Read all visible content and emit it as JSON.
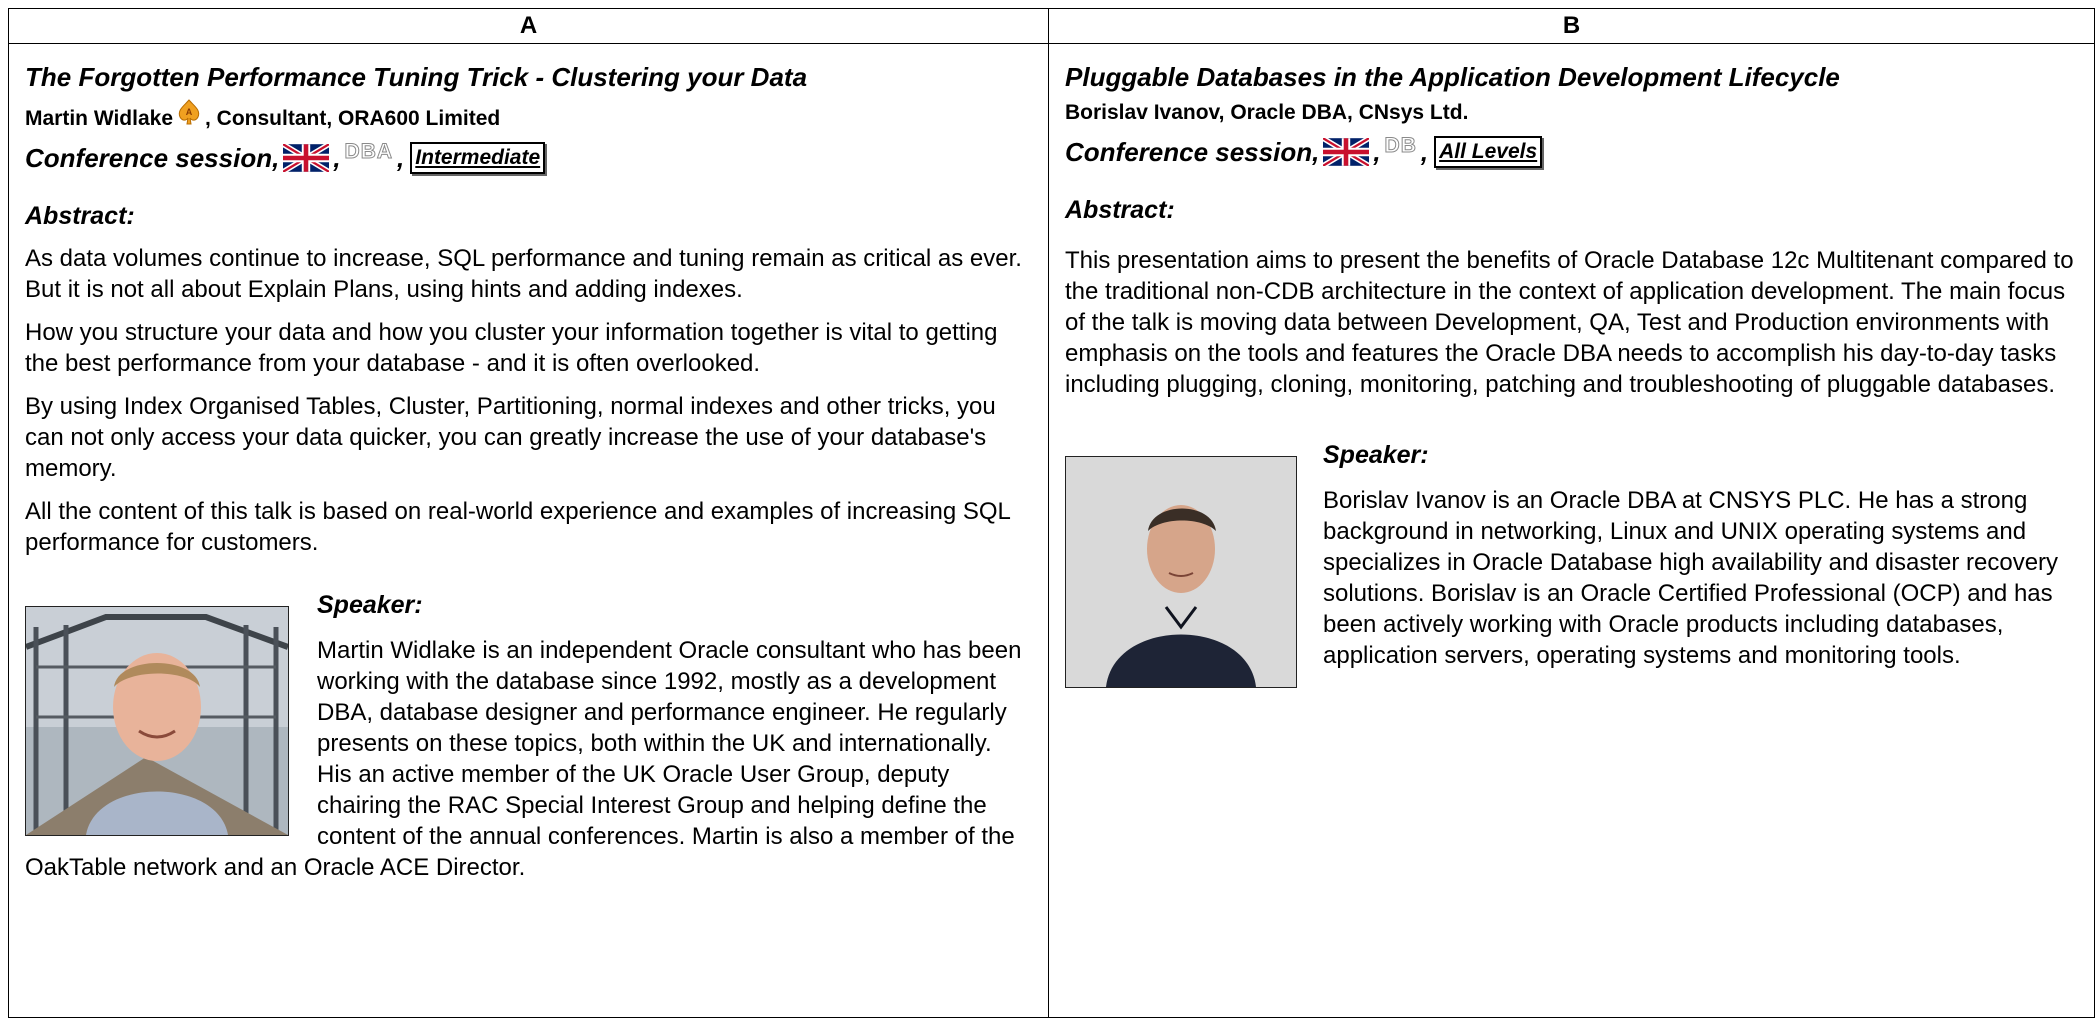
{
  "columns": [
    "A",
    "B"
  ],
  "col_a": {
    "title": "The Forgotten Performance Tuning Trick - Clustering your Data",
    "speaker_line": "Martin Widlake",
    "speaker_line_rest": ", Consultant, ORA600 Limited",
    "session_prefix": "Conference session,",
    "sep1": ",",
    "track_icon_text": "DBA",
    "sep2": ",",
    "level": "Intermediate",
    "abstract_heading": "Abstract:",
    "abstract_paragraphs": [
      "As data volumes continue to increase, SQL performance and tuning remain as critical as ever. But it is not all about Explain Plans, using hints and adding indexes.",
      "How you structure your data and how you cluster your information together is vital to getting the best performance from your database - and it is often overlooked.",
      "By using Index Organised Tables, Cluster, Partitioning, normal indexes and other tricks, you can not only access your data quicker, you can greatly increase the use of your database's memory.",
      "All the content of this talk is based on real-world experience and examples of increasing SQL performance for customers."
    ],
    "speaker_heading": "Speaker:",
    "bio": "Martin Widlake is an independent Oracle consultant who has been working with the database since 1992, mostly as a development DBA, database designer and performance engineer. He regularly presents on these topics, both within the UK and internationally. His an active member of the UK Oracle User Group, deputy chairing the RAC Special Interest Group and helping define the content of the annual conferences. Martin is also a member of the OakTable network and an Oracle ACE Director."
  },
  "col_b": {
    "title": "Pluggable Databases in the Application Development Lifecycle",
    "speaker_line": "Borislav Ivanov, Oracle DBA, CNsys Ltd.",
    "session_prefix": "Conference session,",
    "sep1": ",",
    "track_icon_text": "DB",
    "sep2": ",",
    "level": "All Levels",
    "abstract_heading": "Abstract:",
    "abstract_paragraphs": [
      "This presentation aims to present the benefits of Oracle Database 12c Multitenant compared to the traditional non-CDB architecture in the context of application development. The main focus of the talk is moving data between Development, QA, Test and Production environments with emphasis on the tools and features the Oracle DBA needs to accomplish his day-to-day tasks including plugging, cloning, monitoring, patching and troubleshooting of pluggable databases."
    ],
    "speaker_heading": "Speaker:",
    "bio": "Borislav Ivanov is an Oracle DBA at CNSYS PLC. He has a strong background in networking, Linux and UNIX operating systems and specializes in Oracle Database high availability and disaster recovery solutions. Borislav is an Oracle Certified Professional (OCP) and has been actively working with Oracle products including databases, application servers, operating systems and monitoring tools."
  },
  "icons": {
    "ace": "oracle-ace-icon",
    "flag": "uk-flag-icon",
    "photo_a": "speaker-photo-martin",
    "photo_b": "speaker-photo-borislav"
  }
}
